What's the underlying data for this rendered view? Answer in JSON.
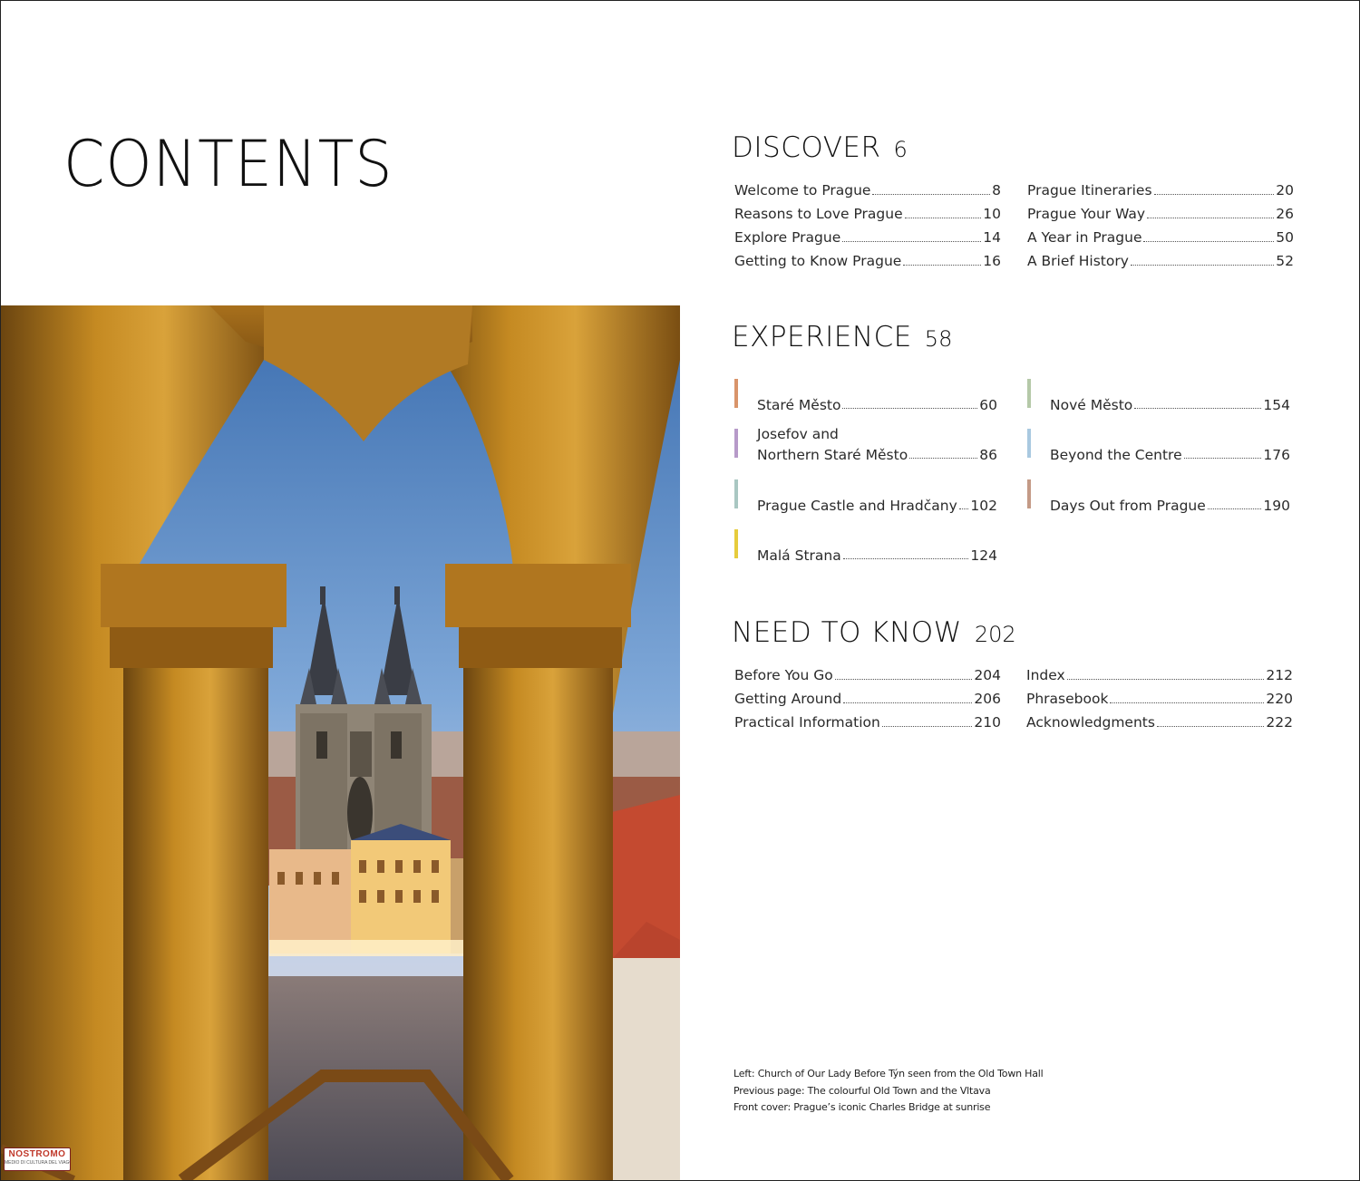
{
  "title": "CONTENTS",
  "colors": {
    "stare_mesto": "#d9946a",
    "josefov": "#b79ac9",
    "prague_castle": "#a9c7c2",
    "mala_strana": "#e6cc3c",
    "nove_mesto": "#b5c9a8",
    "beyond_centre": "#a9c9e0",
    "days_out": "#c49a86"
  },
  "discover": {
    "title": "DISCOVER",
    "page": "6",
    "left": [
      {
        "label": "Welcome to Prague",
        "page": "8"
      },
      {
        "label": "Reasons to Love Prague",
        "page": "10"
      },
      {
        "label": "Explore Prague",
        "page": "14"
      },
      {
        "label": "Getting to Know Prague",
        "page": "16"
      }
    ],
    "right": [
      {
        "label": "Prague Itineraries",
        "page": "20"
      },
      {
        "label": "Prague Your Way",
        "page": "26"
      },
      {
        "label": "A Year in Prague",
        "page": "50"
      },
      {
        "label": "A Brief History",
        "page": "52"
      }
    ]
  },
  "experience": {
    "title": "EXPERIENCE",
    "page": "58",
    "left": [
      {
        "label": "Staré Město",
        "page": "60"
      },
      {
        "label_line1": "Josefov and",
        "label": "Northern Staré Město",
        "page": "86"
      },
      {
        "label": "Prague Castle and Hradčany",
        "page": "102"
      },
      {
        "label": "Malá Strana",
        "page": "124"
      }
    ],
    "right": [
      {
        "label": "Nové Město",
        "page": "154"
      },
      {
        "label": "Beyond the Centre",
        "page": "176"
      },
      {
        "label": "Days Out from Prague",
        "page": "190"
      }
    ]
  },
  "need_to_know": {
    "title": "NEED TO KNOW",
    "page": "202",
    "left": [
      {
        "label": "Before You Go",
        "page": "204"
      },
      {
        "label": "Getting Around",
        "page": "206"
      },
      {
        "label": "Practical Information",
        "page": "210"
      }
    ],
    "right": [
      {
        "label": "Index",
        "page": "212"
      },
      {
        "label": "Phrasebook",
        "page": "220"
      },
      {
        "label": "Acknowledgments",
        "page": "222"
      }
    ]
  },
  "captions": [
    "Left: Church of Our Lady Before Týn seen from the Old Town Hall",
    "Previous page: The colourful Old Town and the Vltava",
    "Front cover: Prague’s iconic Charles Bridge at sunrise"
  ],
  "watermark": {
    "name": "NOSTROMO",
    "tagline": "MEDIO DI CULTURA DEL VIAGGIATORE"
  }
}
